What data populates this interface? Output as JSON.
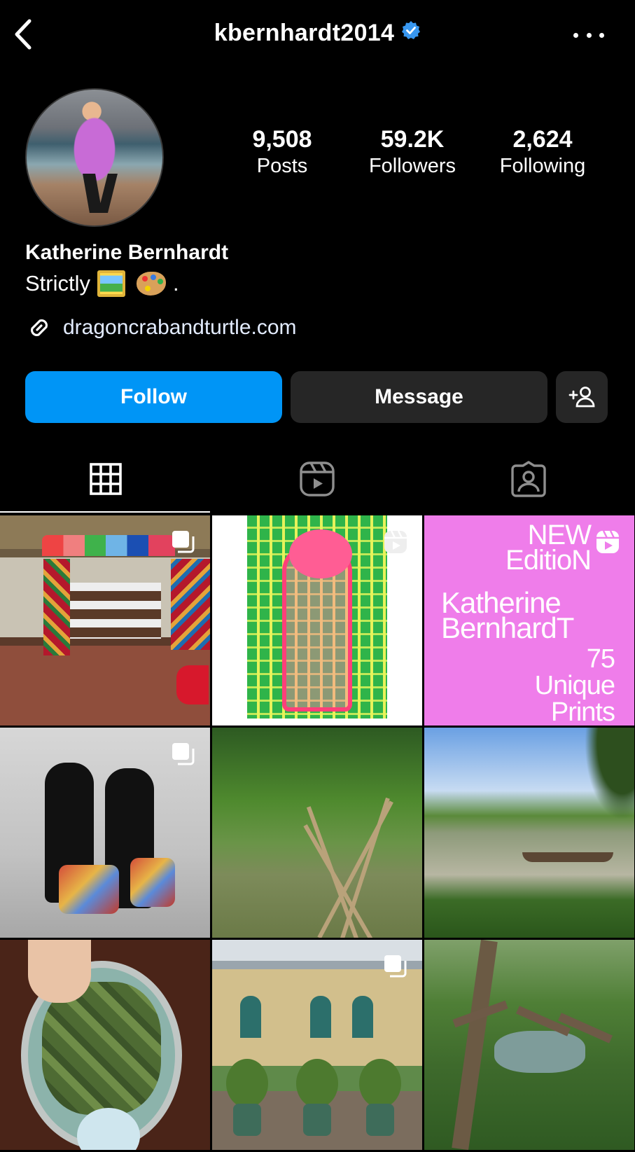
{
  "header": {
    "username": "kbernhardt2014",
    "verified": true,
    "back_icon": "chevron-left-icon",
    "more_icon": "more-horizontal-icon"
  },
  "profile": {
    "stats": [
      {
        "value": "9,508",
        "label": "Posts"
      },
      {
        "value": "59.2K",
        "label": "Followers"
      },
      {
        "value": "2,624",
        "label": "Following"
      }
    ],
    "name": "Katherine Bernhardt",
    "bio_text": "Strictly",
    "bio_emojis": [
      "framed-picture-emoji",
      "artist-palette-emoji"
    ],
    "bio_suffix": ".",
    "link": "dragoncrabandturtle.com"
  },
  "actions": {
    "follow_label": "Follow",
    "message_label": "Message",
    "add_icon": "add-person-icon"
  },
  "tabs": [
    {
      "name": "grid",
      "icon": "grid-icon",
      "active": true
    },
    {
      "name": "reels",
      "icon": "reels-icon",
      "active": false
    },
    {
      "name": "tagged",
      "icon": "tagged-user-icon",
      "active": false
    }
  ],
  "posts": [
    {
      "badge": "carousel"
    },
    {
      "badge": "reel"
    },
    {
      "badge": "reel",
      "text_lines": [
        "NEW",
        "EditioN",
        "Katherine",
        "BernhardT",
        "75",
        "Unique",
        "Prints"
      ]
    },
    {
      "badge": "carousel"
    },
    {
      "badge": ""
    },
    {
      "badge": ""
    },
    {
      "badge": ""
    },
    {
      "badge": "carousel"
    },
    {
      "badge": ""
    }
  ],
  "colors": {
    "background": "#000000",
    "follow_button": "#0095f6",
    "secondary_button": "#262626",
    "verified_badge": "#3897f0"
  }
}
